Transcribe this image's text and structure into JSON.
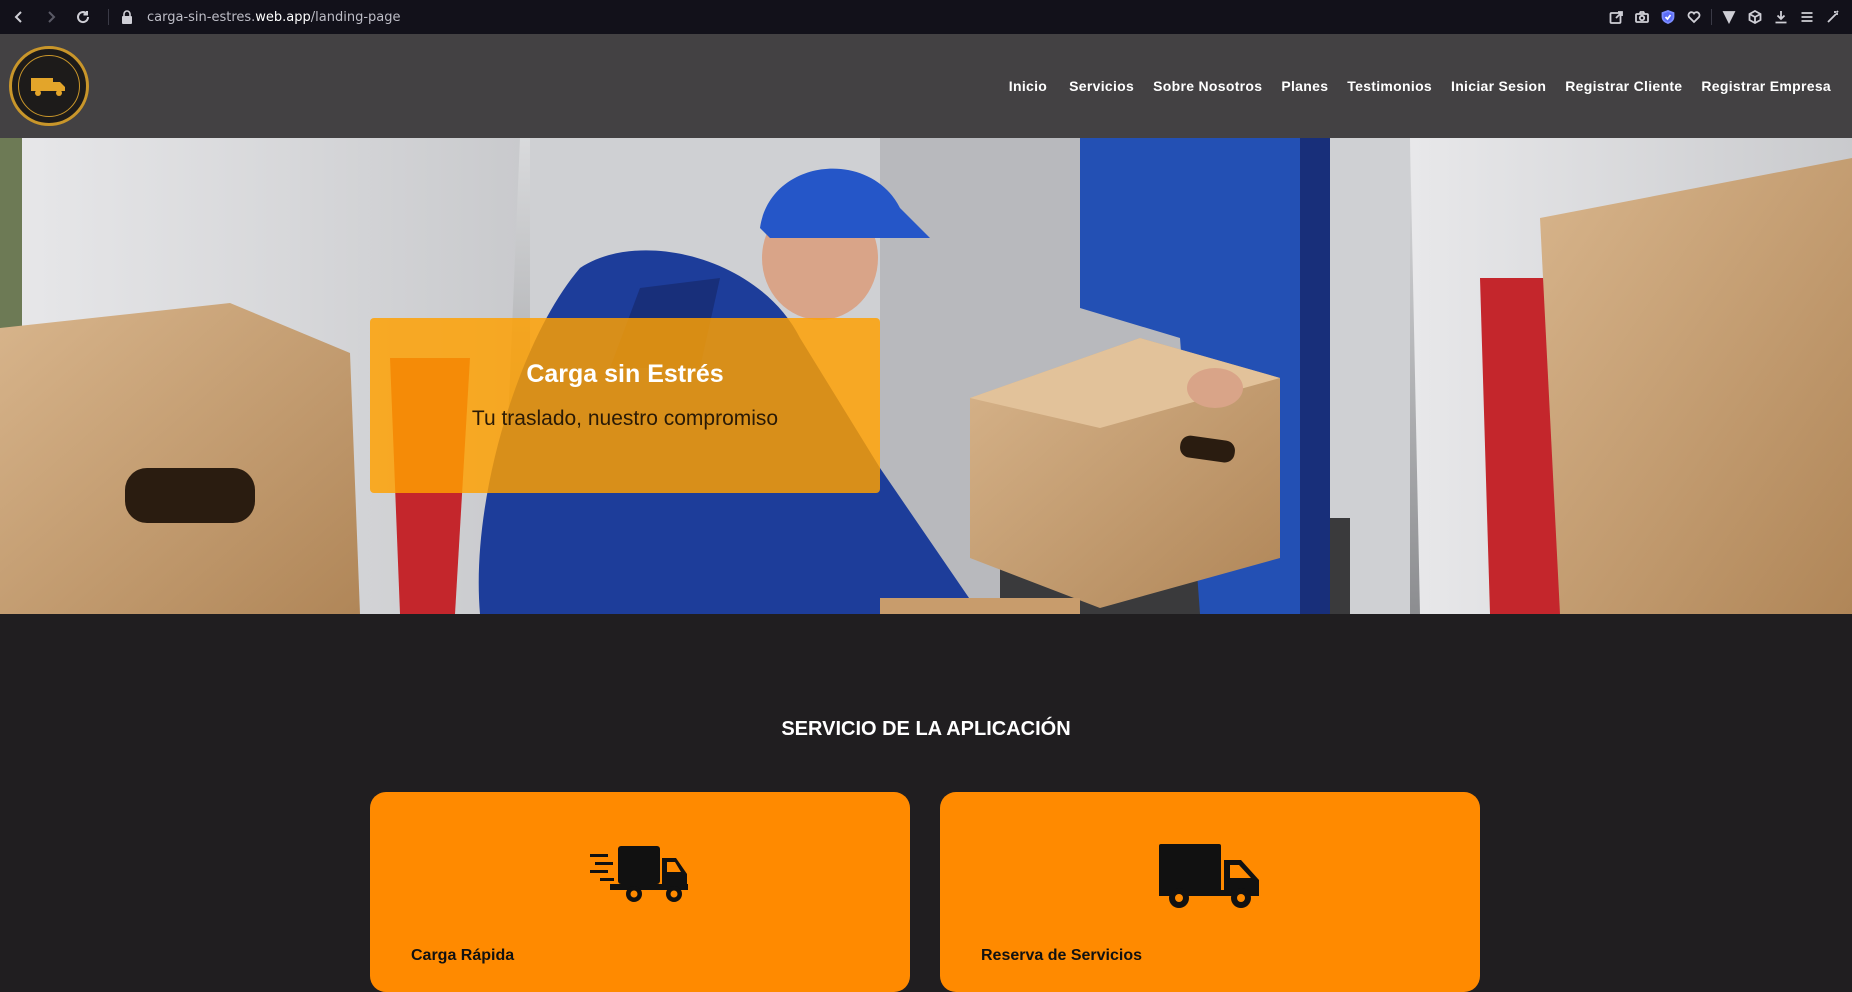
{
  "browser": {
    "url_prefix": "carga-sin-estres.",
    "url_domain": "web.app",
    "url_path": "/landing-page"
  },
  "site": {
    "logo_alt": "Carga sin Estrés logo",
    "nav": [
      "Inicio",
      "Servicios",
      "Sobre Nosotros",
      "Planes",
      "Testimonios",
      "Iniciar Sesion",
      "Registrar Cliente",
      "Registrar Empresa"
    ]
  },
  "hero": {
    "title": "Carga sin Estrés",
    "subtitle": "Tu traslado, nuestro compromiso"
  },
  "services": {
    "heading": "SERVICIO DE LA APLICACIÓN",
    "cards": [
      {
        "title": "Carga Rápida",
        "icon": "fast-truck-icon"
      },
      {
        "title": "Reserva de Servicios",
        "icon": "truck-icon"
      }
    ]
  },
  "colors": {
    "header_bg": "#434143",
    "page_bg": "#201e20",
    "accent": "#ff8a00",
    "hero_box": "#ffa000"
  }
}
